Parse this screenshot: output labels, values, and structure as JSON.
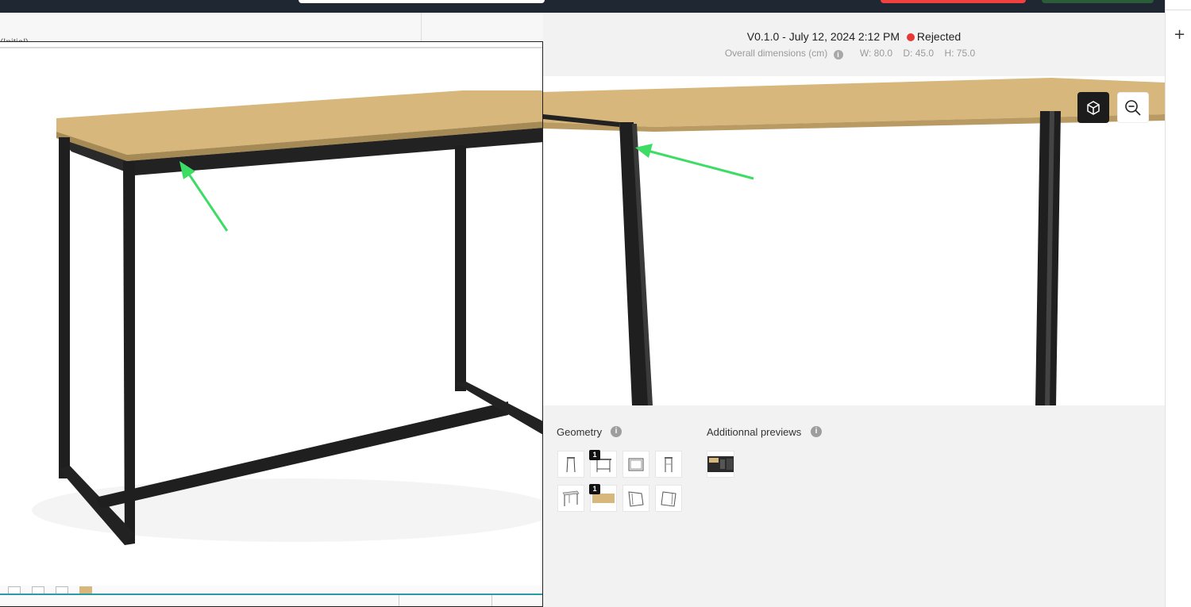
{
  "topbar": {
    "search": "",
    "reject_action": "",
    "approve_action": ""
  },
  "version": {
    "label": "V0.1.0 - July 12, 2024 2:12 PM",
    "status": "Rejected",
    "status_color": "#e53935"
  },
  "dimensions": {
    "label": "Overall dimensions (cm)",
    "info_icon": "i",
    "width": "W: 80.0",
    "depth": "D: 45.0",
    "height": "H: 75.0"
  },
  "viewer": {
    "cube_button_icon": "cube-icon",
    "zoom_button_icon": "zoom-out-icon"
  },
  "geometry": {
    "label": "Geometry",
    "info_icon": "i",
    "thumbnails": [
      {
        "icon": "front-view-icon",
        "badge": ""
      },
      {
        "icon": "side-view-icon",
        "badge": "1"
      },
      {
        "icon": "top-view-icon",
        "badge": ""
      },
      {
        "icon": "back-view-icon",
        "badge": ""
      },
      {
        "icon": "angle-view-icon",
        "badge": ""
      },
      {
        "icon": "wood-texture-icon",
        "badge": "1"
      },
      {
        "icon": "angle-right-view-icon",
        "badge": ""
      },
      {
        "icon": "angle-left-view-icon",
        "badge": ""
      }
    ]
  },
  "additional_previews": {
    "label": "Additionnal previews",
    "info_icon": "i"
  },
  "left_panel": {
    "faint_text": "(Initial)"
  },
  "colors": {
    "accent": "#e53935",
    "arrow": "#3ddc64",
    "wood": "#d7b77b",
    "frame": "#1f1f1f"
  },
  "right_rail": {
    "plus": "+"
  }
}
